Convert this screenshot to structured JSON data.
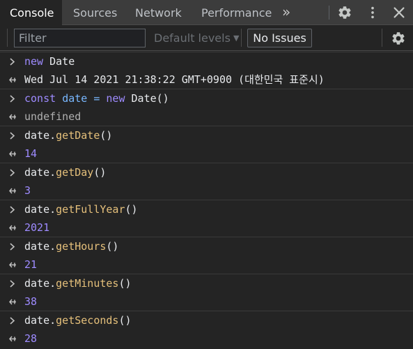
{
  "tabs": {
    "console": "Console",
    "sources": "Sources",
    "network": "Network",
    "performance": "Performance",
    "more": "»"
  },
  "toolbar": {
    "filter_placeholder": "Filter",
    "levels_label": "Default levels",
    "levels_caret": "▼",
    "issues_label": "No Issues"
  },
  "entries": [
    {
      "input": [
        {
          "t": "new",
          "c": "kw"
        },
        {
          "t": " Date",
          "c": "plain"
        }
      ],
      "output": [
        {
          "t": "Wed Jul 14 2021 21:38:22 GMT+0900 (대한민국 표준시)",
          "c": "plain"
        }
      ]
    },
    {
      "input": [
        {
          "t": "const",
          "c": "kw"
        },
        {
          "t": " ",
          "c": "plain"
        },
        {
          "t": "date",
          "c": "var"
        },
        {
          "t": " = ",
          "c": "var"
        },
        {
          "t": "new",
          "c": "kw"
        },
        {
          "t": " Date()",
          "c": "plain"
        }
      ],
      "output": [
        {
          "t": "undefined",
          "c": "undef"
        }
      ]
    },
    {
      "input": [
        {
          "t": "date.",
          "c": "plain"
        },
        {
          "t": "getDate",
          "c": "fn"
        },
        {
          "t": "()",
          "c": "plain"
        }
      ],
      "output": [
        {
          "t": "14",
          "c": "num"
        }
      ]
    },
    {
      "input": [
        {
          "t": "date.",
          "c": "plain"
        },
        {
          "t": "getDay",
          "c": "fn"
        },
        {
          "t": "()",
          "c": "plain"
        }
      ],
      "output": [
        {
          "t": "3",
          "c": "num"
        }
      ]
    },
    {
      "input": [
        {
          "t": "date.",
          "c": "plain"
        },
        {
          "t": "getFullYear",
          "c": "fn"
        },
        {
          "t": "()",
          "c": "plain"
        }
      ],
      "output": [
        {
          "t": "2021",
          "c": "num"
        }
      ]
    },
    {
      "input": [
        {
          "t": "date.",
          "c": "plain"
        },
        {
          "t": "getHours",
          "c": "fn"
        },
        {
          "t": "()",
          "c": "plain"
        }
      ],
      "output": [
        {
          "t": "21",
          "c": "num"
        }
      ]
    },
    {
      "input": [
        {
          "t": "date.",
          "c": "plain"
        },
        {
          "t": "getMinutes",
          "c": "fn"
        },
        {
          "t": "()",
          "c": "plain"
        }
      ],
      "output": [
        {
          "t": "38",
          "c": "num"
        }
      ]
    },
    {
      "input": [
        {
          "t": "date.",
          "c": "plain"
        },
        {
          "t": "getSeconds",
          "c": "fn"
        },
        {
          "t": "()",
          "c": "plain"
        }
      ],
      "output": [
        {
          "t": "28",
          "c": "num"
        }
      ]
    }
  ],
  "icons": {
    "input_prompt": "chevron-right-icon",
    "output_result": "return-arrow-icon",
    "settings": "gear-icon",
    "menu": "kebab-icon",
    "close": "close-icon"
  },
  "colors": {
    "background": "#242424",
    "tabbar": "#3c3c3c",
    "keyword": "#9e8bff",
    "variable": "#79b8ff",
    "method": "#e5c07b",
    "number": "#9e8bff"
  }
}
